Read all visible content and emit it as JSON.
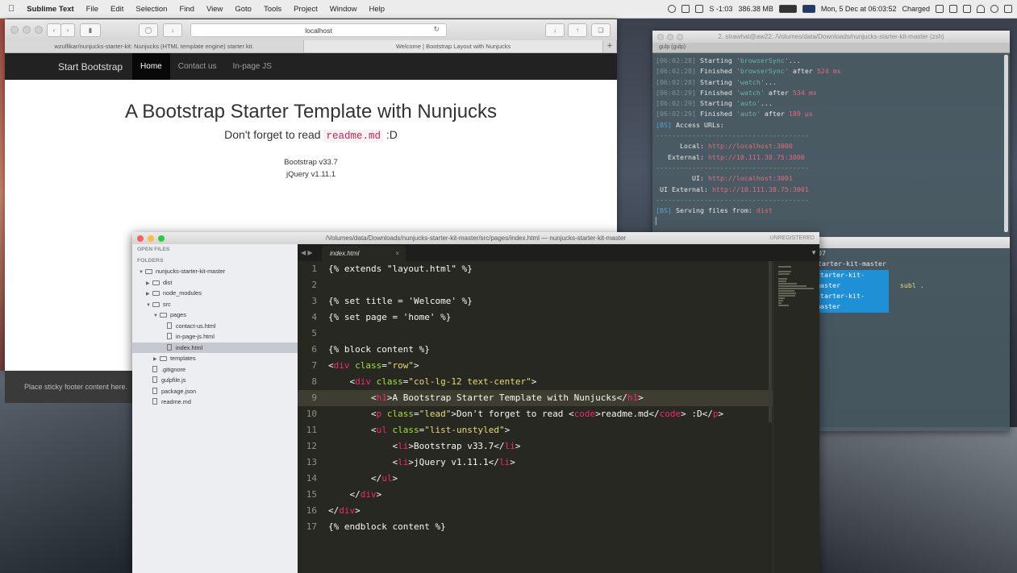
{
  "menubar": {
    "items": [
      "Sublime Text",
      "File",
      "Edit",
      "Selection",
      "Find",
      "View",
      "Goto",
      "Tools",
      "Project",
      "Window",
      "Help"
    ],
    "tray": [
      "S -1:03",
      "386.38 MB",
      "Mon, 5 Dec at 06:03:52",
      "Charged"
    ]
  },
  "browser": {
    "url": "localhost",
    "tabs": [
      "wzulfikar/nunjucks-starter-kit: Nunjucks (HTML template engine) starter kit.",
      "Welcome | Bootstrap Layout with Nunjucks",
      "+"
    ],
    "brand": "Start Bootstrap",
    "nav": [
      "Home",
      "Contact us",
      "In-page JS"
    ],
    "heading": "A Bootstrap Starter Template with Nunjucks",
    "lead_pre": "Don't forget to read",
    "lead_code": "readme.md",
    "lead_post": ":D",
    "list": [
      "Bootstrap v33.7",
      "jQuery v1.11.1"
    ],
    "footer": "Place sticky footer content here."
  },
  "terminal": {
    "title": "2. strawhat@aw22: /Volumes/data/Downloads/nunjucks-starter-kit-master (zsh)",
    "tab": "gulp (gulp)",
    "lines": [
      {
        "time": "[06:02:28]",
        "msg": " Starting ",
        "task": "'browserSync'",
        "tail": "..."
      },
      {
        "time": "[06:02:28]",
        "msg": " Finished ",
        "task": "'browserSync'",
        "tail": " after ",
        "ms": "524 ms"
      },
      {
        "time": "[06:02:28]",
        "msg": " Starting ",
        "task": "'watch'",
        "tail": "..."
      },
      {
        "time": "[06:02:29]",
        "msg": " Finished ",
        "task": "'watch'",
        "tail": " after ",
        "ms": "534 ms"
      },
      {
        "time": "[06:02:29]",
        "msg": " Starting ",
        "task": "'auto'",
        "tail": "..."
      },
      {
        "time": "[06:02:29]",
        "msg": " Finished ",
        "task": "'auto'",
        "tail": " after ",
        "ms": "189 μs"
      }
    ],
    "bs_access": "Access URLs:",
    "rule": "--------------------------------------",
    "local_label": "      Local:",
    "local_url": "http://localhost:3000",
    "external_label": "   External:",
    "external_url": "http://10.111.38.75:3000",
    "ui_label": "         UI:",
    "ui_url": "http://localhost:3001",
    "uiext_label": " UI External:",
    "uiext_url": "http://10.111.38.75:3001",
    "serving": "Serving files from: ",
    "dist": "dist",
    "bs_tag": "[BS]",
    "lower_lines": [
      "007",
      "starter-kit-master",
      "starter-kit-master",
      "starter-kit-master"
    ],
    "lower_cmd": "subl ."
  },
  "sublime": {
    "title": "/Volumes/data/Downloads/nunjucks-starter-kit-master/src/pages/index.html — nunjucks-starter-kit-master",
    "unregistered": "UNREGISTERED",
    "sidebar": {
      "open_files": "OPEN FILES",
      "folders": "FOLDERS",
      "tree": [
        {
          "label": "nunjucks-starter-kit-master",
          "depth": 0,
          "type": "folder",
          "open": true
        },
        {
          "label": "dist",
          "depth": 1,
          "type": "folder",
          "open": false
        },
        {
          "label": "node_modules",
          "depth": 1,
          "type": "folder",
          "open": false
        },
        {
          "label": "src",
          "depth": 1,
          "type": "folder",
          "open": true
        },
        {
          "label": "pages",
          "depth": 2,
          "type": "folder",
          "open": true
        },
        {
          "label": "contact-us.html",
          "depth": 3,
          "type": "file"
        },
        {
          "label": "in-page-js.html",
          "depth": 3,
          "type": "file"
        },
        {
          "label": "index.html",
          "depth": 3,
          "type": "file",
          "selected": true
        },
        {
          "label": "templates",
          "depth": 2,
          "type": "folder",
          "open": false
        },
        {
          "label": ".gitignore",
          "depth": 1,
          "type": "file"
        },
        {
          "label": "gulpfile.js",
          "depth": 1,
          "type": "file"
        },
        {
          "label": "package.json",
          "depth": 1,
          "type": "file"
        },
        {
          "label": "readme.md",
          "depth": 1,
          "type": "file"
        }
      ]
    },
    "tab": "index.html",
    "code": [
      [
        {
          "t": "{% extends \"layout.html\" %}",
          "c": "src"
        }
      ],
      [],
      [
        {
          "t": "{% set title = 'Welcome' %}",
          "c": "src"
        }
      ],
      [
        {
          "t": "{% set page = 'home' %}",
          "c": "src"
        }
      ],
      [],
      [
        {
          "t": "{% block content %}",
          "c": "src"
        }
      ],
      [
        {
          "t": "<",
          "c": "src"
        },
        {
          "t": "div",
          "c": "k"
        },
        {
          "t": " ",
          "c": "src"
        },
        {
          "t": "class",
          "c": "a"
        },
        {
          "t": "=",
          "c": "src"
        },
        {
          "t": "\"row\"",
          "c": "q"
        },
        {
          "t": ">",
          "c": "src"
        }
      ],
      [
        {
          "t": "    <",
          "c": "src"
        },
        {
          "t": "div",
          "c": "k"
        },
        {
          "t": " ",
          "c": "src"
        },
        {
          "t": "class",
          "c": "a"
        },
        {
          "t": "=",
          "c": "src"
        },
        {
          "t": "\"col-lg-12 text-center\"",
          "c": "q"
        },
        {
          "t": ">",
          "c": "src"
        }
      ],
      [
        {
          "t": "        <",
          "c": "src"
        },
        {
          "t": "h1",
          "c": "k"
        },
        {
          "t": ">A Bootstrap Starter Template with Nunjucks</",
          "c": "src"
        },
        {
          "t": "h1",
          "c": "k"
        },
        {
          "t": ">",
          "c": "src"
        }
      ],
      [
        {
          "t": "        <",
          "c": "src"
        },
        {
          "t": "p",
          "c": "k"
        },
        {
          "t": " ",
          "c": "src"
        },
        {
          "t": "class",
          "c": "a"
        },
        {
          "t": "=",
          "c": "src"
        },
        {
          "t": "\"lead\"",
          "c": "q"
        },
        {
          "t": ">Don't forget to read <",
          "c": "src"
        },
        {
          "t": "code",
          "c": "k"
        },
        {
          "t": ">readme.md</",
          "c": "src"
        },
        {
          "t": "code",
          "c": "k"
        },
        {
          "t": "> :D</",
          "c": "src"
        },
        {
          "t": "p",
          "c": "k"
        },
        {
          "t": ">",
          "c": "src"
        }
      ],
      [
        {
          "t": "        <",
          "c": "src"
        },
        {
          "t": "ul",
          "c": "k"
        },
        {
          "t": " ",
          "c": "src"
        },
        {
          "t": "class",
          "c": "a"
        },
        {
          "t": "=",
          "c": "src"
        },
        {
          "t": "\"list-unstyled\"",
          "c": "q"
        },
        {
          "t": ">",
          "c": "src"
        }
      ],
      [
        {
          "t": "            <",
          "c": "src"
        },
        {
          "t": "li",
          "c": "k"
        },
        {
          "t": ">Bootstrap v33.7</",
          "c": "src"
        },
        {
          "t": "li",
          "c": "k"
        },
        {
          "t": ">",
          "c": "src"
        }
      ],
      [
        {
          "t": "            <",
          "c": "src"
        },
        {
          "t": "li",
          "c": "k"
        },
        {
          "t": ">jQuery v1.11.1</",
          "c": "src"
        },
        {
          "t": "li",
          "c": "k"
        },
        {
          "t": ">",
          "c": "src"
        }
      ],
      [
        {
          "t": "        </",
          "c": "src"
        },
        {
          "t": "ul",
          "c": "k"
        },
        {
          "t": ">",
          "c": "src"
        }
      ],
      [
        {
          "t": "    </",
          "c": "src"
        },
        {
          "t": "div",
          "c": "k"
        },
        {
          "t": ">",
          "c": "src"
        }
      ],
      [
        {
          "t": "</",
          "c": "src"
        },
        {
          "t": "div",
          "c": "k"
        },
        {
          "t": ">",
          "c": "src"
        }
      ],
      [
        {
          "t": "{% endblock content %}",
          "c": "src"
        }
      ]
    ],
    "current_line": 9
  }
}
